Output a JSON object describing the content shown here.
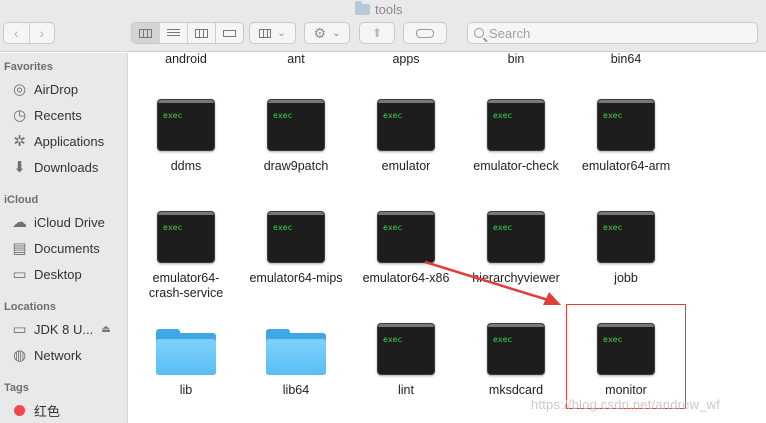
{
  "window": {
    "title": "tools"
  },
  "toolbar": {
    "back_glyph": "‹",
    "forward_glyph": "›",
    "search_placeholder": "Search",
    "gear_glyph": "⚙",
    "share_glyph": "⬆",
    "chevron": "⌄"
  },
  "sidebar": {
    "favorites_title": "Favorites",
    "favorites": [
      {
        "label": "AirDrop",
        "icon": "airdrop-icon",
        "glyph": "◎"
      },
      {
        "label": "Recents",
        "icon": "recents-icon",
        "glyph": "◷"
      },
      {
        "label": "Applications",
        "icon": "applications-icon",
        "glyph": "✲"
      },
      {
        "label": "Downloads",
        "icon": "downloads-icon",
        "glyph": "⬇"
      }
    ],
    "icloud_title": "iCloud",
    "icloud": [
      {
        "label": "iCloud Drive",
        "icon": "cloud-icon",
        "glyph": "☁"
      },
      {
        "label": "Documents",
        "icon": "document-icon",
        "glyph": "▤"
      },
      {
        "label": "Desktop",
        "icon": "desktop-icon",
        "glyph": "▭"
      }
    ],
    "locations_title": "Locations",
    "locations": [
      {
        "label": "JDK 8 U...",
        "icon": "disk-icon",
        "glyph": "▭",
        "eject": "⏏"
      },
      {
        "label": "Network",
        "icon": "network-icon",
        "glyph": "◍"
      }
    ],
    "tags_title": "Tags",
    "tags": [
      {
        "label": "红色",
        "color": "#f2484c"
      }
    ]
  },
  "files": {
    "exec_label": "exec",
    "row0": [
      "android",
      "ant",
      "apps",
      "bin",
      "bin64"
    ],
    "row1": [
      "ddms",
      "draw9patch",
      "emulator",
      "emulator-check",
      "emulator64-arm"
    ],
    "row2": [
      "emulator64-\ncrash-service",
      "emulator64-mips",
      "emulator64-x86",
      "hierarchyviewer",
      "jobb"
    ],
    "row3": [
      "lib",
      "lib64",
      "lint",
      "mksdcard",
      "monitor"
    ]
  },
  "annotation": {
    "highlight_color": "#e0403c",
    "watermark": "https://blog.csdn.net/andrew_wf"
  }
}
